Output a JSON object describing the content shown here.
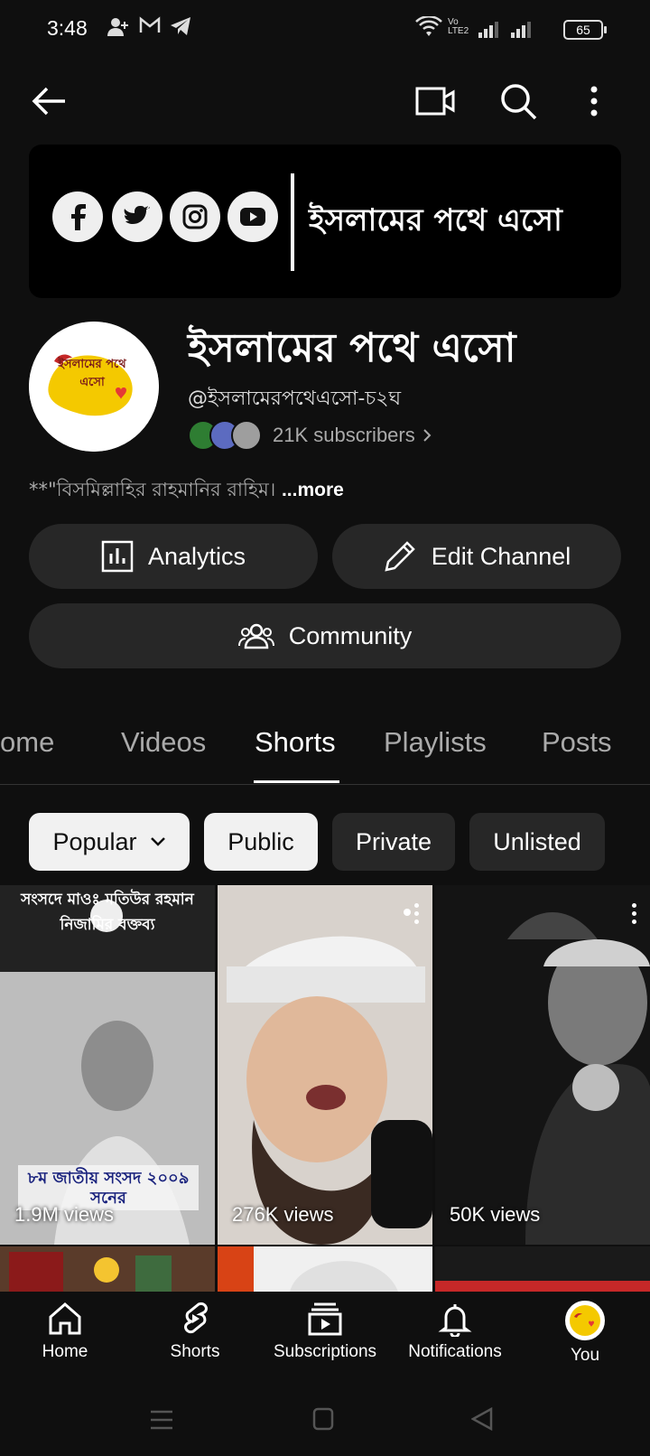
{
  "status_bar": {
    "time": "3:48",
    "network_label": "Vo LTE2",
    "battery": "65"
  },
  "banner": {
    "title": "ইসলামের পথে এসো",
    "social_icons": [
      "facebook-icon",
      "twitter-icon",
      "instagram-icon",
      "youtube-icon"
    ]
  },
  "channel": {
    "name": "ইসলামের পথে এসো",
    "handle": "@ইসলামেরপথেএসো-চ২ঘ",
    "subscribers": "21K subscribers",
    "description": "**\"বিসমিল্লাহির রাহমানির রাহিম।",
    "more_label": "...more",
    "avatar_text": "ইসলামের পথে এসো"
  },
  "actions": {
    "analytics": "Analytics",
    "edit_channel": "Edit Channel",
    "community": "Community"
  },
  "tabs": [
    {
      "label": "ome"
    },
    {
      "label": "Videos"
    },
    {
      "label": "Shorts"
    },
    {
      "label": "Playlists"
    },
    {
      "label": "Posts"
    }
  ],
  "active_tab": "Shorts",
  "filters": [
    {
      "label": "Popular"
    },
    {
      "label": "Public"
    },
    {
      "label": "Private"
    },
    {
      "label": "Unlisted"
    }
  ],
  "shorts": [
    {
      "views": "1.9M views",
      "overlay_top": "সংসদে মাওঃ মতিউর রহমান নিজামির বক্তব্য",
      "overlay_bottom": "৮ম জাতীয় সংসদ ২০০৯ সনের"
    },
    {
      "views": "276K views"
    },
    {
      "views": "50K views"
    }
  ],
  "bottom_nav": [
    {
      "label": "Home"
    },
    {
      "label": "Shorts"
    },
    {
      "label": "Subscriptions"
    },
    {
      "label": "Notifications"
    },
    {
      "label": "You"
    }
  ],
  "colors": {
    "background": "#0f0f0f",
    "surface": "#272727",
    "text_primary": "#f1f1f1",
    "text_secondary": "#aaaaaa"
  }
}
